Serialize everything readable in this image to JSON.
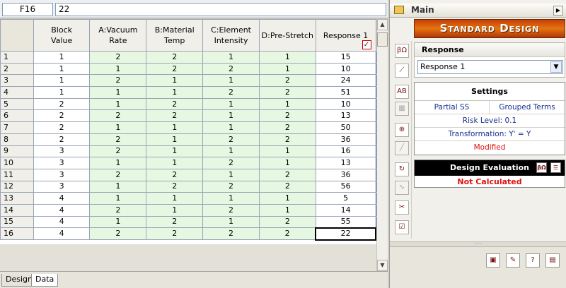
{
  "formula_bar": {
    "cell_ref": "F16",
    "cell_value": "22"
  },
  "grid": {
    "columns": [
      "Block\nValue",
      "A:Vacuum\nRate",
      "B:Material\nTemp",
      "C:Element\nIntensity",
      "D:Pre-Stretch",
      "Response 1"
    ],
    "rows": [
      [
        "1",
        "1",
        "2",
        "2",
        "1",
        "1",
        "15"
      ],
      [
        "2",
        "1",
        "1",
        "2",
        "2",
        "1",
        "10"
      ],
      [
        "3",
        "1",
        "2",
        "1",
        "1",
        "2",
        "24"
      ],
      [
        "4",
        "1",
        "1",
        "1",
        "2",
        "2",
        "51"
      ],
      [
        "5",
        "2",
        "1",
        "2",
        "1",
        "1",
        "10"
      ],
      [
        "6",
        "2",
        "2",
        "2",
        "1",
        "2",
        "13"
      ],
      [
        "7",
        "2",
        "1",
        "1",
        "1",
        "2",
        "50"
      ],
      [
        "8",
        "2",
        "2",
        "1",
        "2",
        "2",
        "36"
      ],
      [
        "9",
        "3",
        "2",
        "1",
        "1",
        "1",
        "16"
      ],
      [
        "10",
        "3",
        "1",
        "1",
        "2",
        "1",
        "13"
      ],
      [
        "11",
        "3",
        "2",
        "2",
        "1",
        "2",
        "36"
      ],
      [
        "12",
        "3",
        "1",
        "2",
        "2",
        "2",
        "56"
      ],
      [
        "13",
        "4",
        "1",
        "1",
        "1",
        "1",
        "5"
      ],
      [
        "14",
        "4",
        "2",
        "1",
        "2",
        "1",
        "14"
      ],
      [
        "15",
        "4",
        "1",
        "2",
        "1",
        "2",
        "55"
      ],
      [
        "16",
        "4",
        "2",
        "2",
        "2",
        "2",
        "22"
      ]
    ],
    "checkbox_icon": "check-icon"
  },
  "tabs": [
    {
      "label": "Design"
    },
    {
      "label": "Data"
    }
  ],
  "panel": {
    "title": "Main",
    "banner": "Standard Design",
    "response": {
      "header": "Response",
      "selected": "Response 1"
    },
    "settings": {
      "header": "Settings",
      "ss_type": "Partial SS",
      "terms": "Grouped Terms",
      "risk": "Risk Level: 0.1",
      "transformation": "Transformation: Y' = Y",
      "status": "Modified"
    },
    "evaluation": {
      "header": "Design Evaluation",
      "status": "Not Calculated"
    },
    "colors": {
      "banner": "#e4740e",
      "status_red": "#e01010",
      "settings_blue": "#1b2f90",
      "factor_green": "#e6f8e1"
    }
  }
}
